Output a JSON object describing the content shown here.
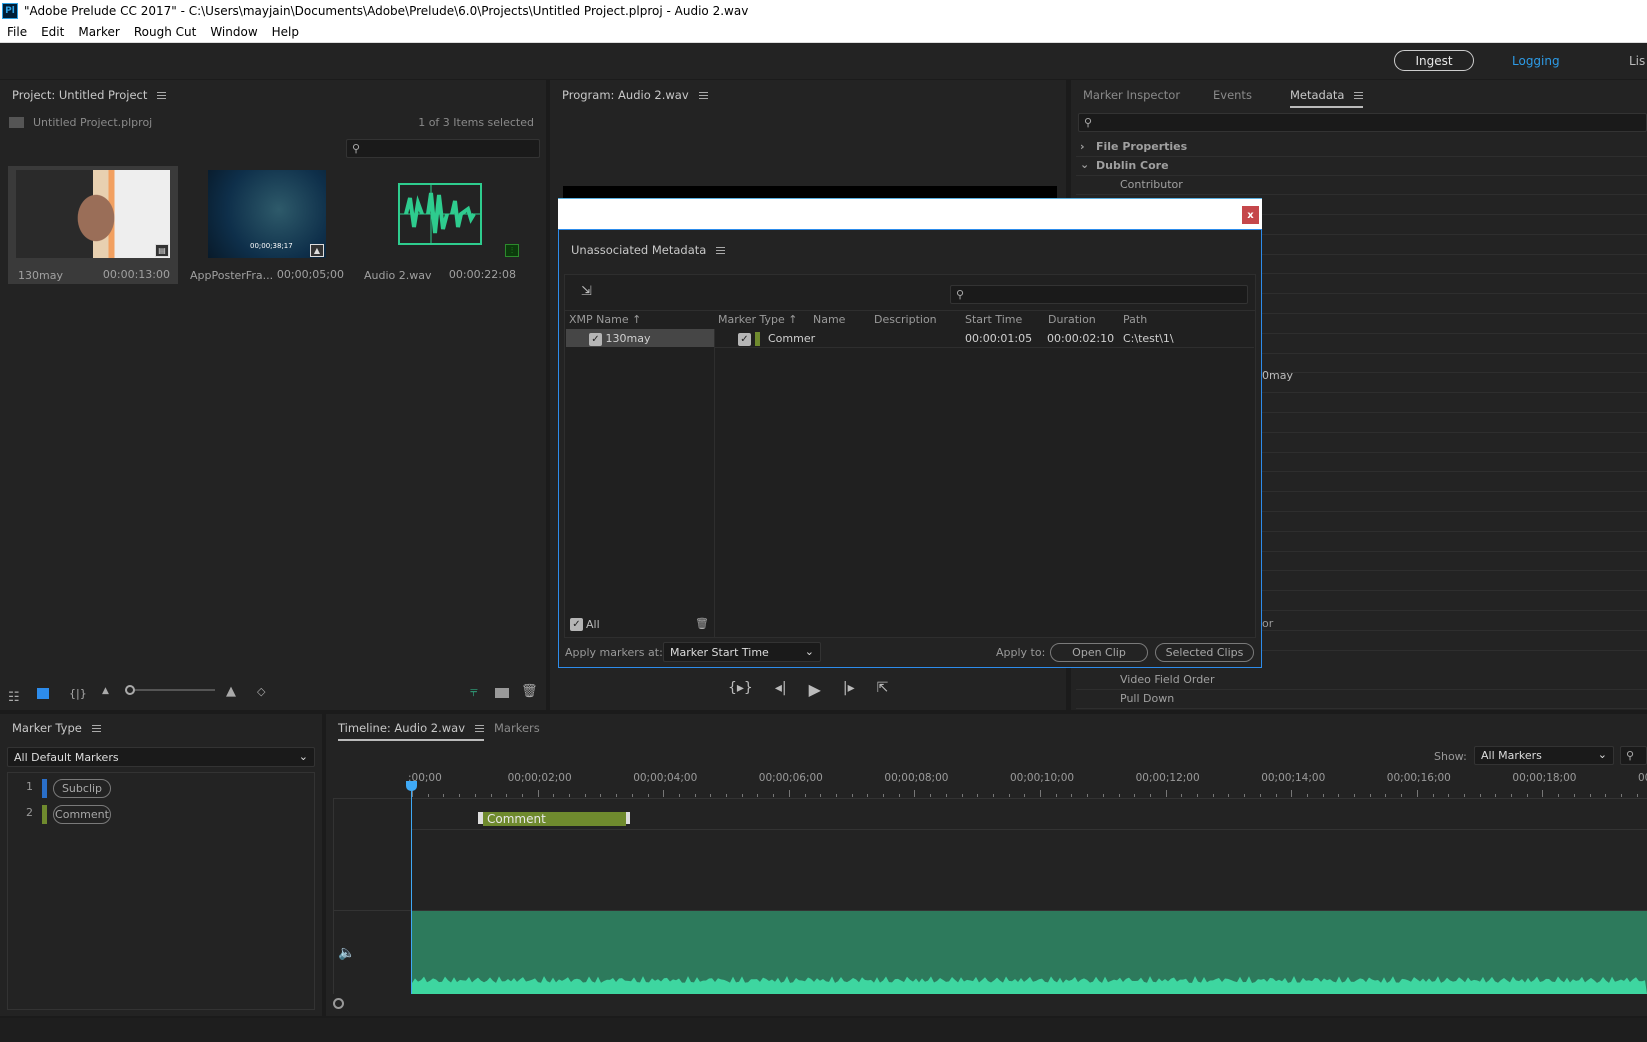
{
  "window": {
    "app_icon": "Pl",
    "title": "\"Adobe Prelude CC 2017\" - C:\\Users\\mayjain\\Documents\\Adobe\\Prelude\\6.0\\Projects\\Untitled Project.plproj - Audio 2.wav"
  },
  "menu": [
    "File",
    "Edit",
    "Marker",
    "Rough Cut",
    "Window",
    "Help"
  ],
  "workspaces": {
    "ingest": "Ingest",
    "logging": "Logging",
    "list": "Lis",
    "active": "Logging",
    "accent": "#2d9be6"
  },
  "project": {
    "title": "Project: Untitled Project",
    "file": "Untitled Project.plproj",
    "selection": "1 of 3 Items selected",
    "search_placeholder": "",
    "items": [
      {
        "name": "130may",
        "duration": "00:00:13:00",
        "type": "video",
        "selected": true
      },
      {
        "name": "AppPosterFra...",
        "duration": "00;00;05;00",
        "type": "image",
        "overlay": "00;00;38;17"
      },
      {
        "name": "Audio 2.wav",
        "duration": "00:00:22:08",
        "type": "audio"
      }
    ]
  },
  "program": {
    "title": "Program: Audio 2.wav"
  },
  "metadata_panel": {
    "tabs": [
      "Marker Inspector",
      "Events",
      "Metadata"
    ],
    "active_tab": "Metadata",
    "sections": [
      {
        "label": "File Properties",
        "expanded": false
      },
      {
        "label": "Dublin Core",
        "expanded": true
      }
    ],
    "rows": [
      "Contributor",
      "Video Field Order",
      "Pull Down"
    ],
    "partial_values": [
      "0may",
      "or"
    ]
  },
  "dialog": {
    "title": "Unassociated Metadata",
    "close": "x",
    "columns": [
      "XMP Name",
      "Marker Type",
      "Name",
      "Description",
      "Start Time",
      "Duration",
      "Path"
    ],
    "xmp_items": [
      {
        "name": "130may",
        "checked": true
      }
    ],
    "markers": [
      {
        "checked": true,
        "type": "Commer",
        "name": "",
        "description": "",
        "start": "00:00:01:05",
        "duration": "00:00:02:10",
        "path": "C:\\test\\1\\",
        "color": "#6f8a2e"
      }
    ],
    "all_label": "All",
    "all_checked": true,
    "apply_at_label": "Apply markers at:",
    "apply_at_value": "Marker Start Time",
    "apply_to_label": "Apply to:",
    "open_clip": "Open Clip",
    "selected_clips": "Selected Clips"
  },
  "marker_type": {
    "title": "Marker Type",
    "preset": "All Default Markers",
    "items": [
      {
        "num": "1",
        "label": "Subclip",
        "color": "#2a6fc9"
      },
      {
        "num": "2",
        "label": "Comment",
        "color": "#6f8a2e"
      }
    ]
  },
  "timeline": {
    "tabs": [
      "Timeline: Audio 2.wav",
      "Markers"
    ],
    "active_tab": "Timeline: Audio 2.wav",
    "show_label": "Show:",
    "show_value": "All Markers",
    "ruler": [
      ":00;00",
      "00;00;02;00",
      "00;00;04;00",
      "00;00;06;00",
      "00;00;08;00",
      "00;00;10;00",
      "00;00;12;00",
      "00;00;14;00",
      "00;00;16;00",
      "00;00;18;00",
      "00"
    ],
    "marker": {
      "label": "Comment",
      "color": "#6f8a2e"
    },
    "playhead_color": "#3fa9f5",
    "audio_color": "#2d7a5c"
  }
}
